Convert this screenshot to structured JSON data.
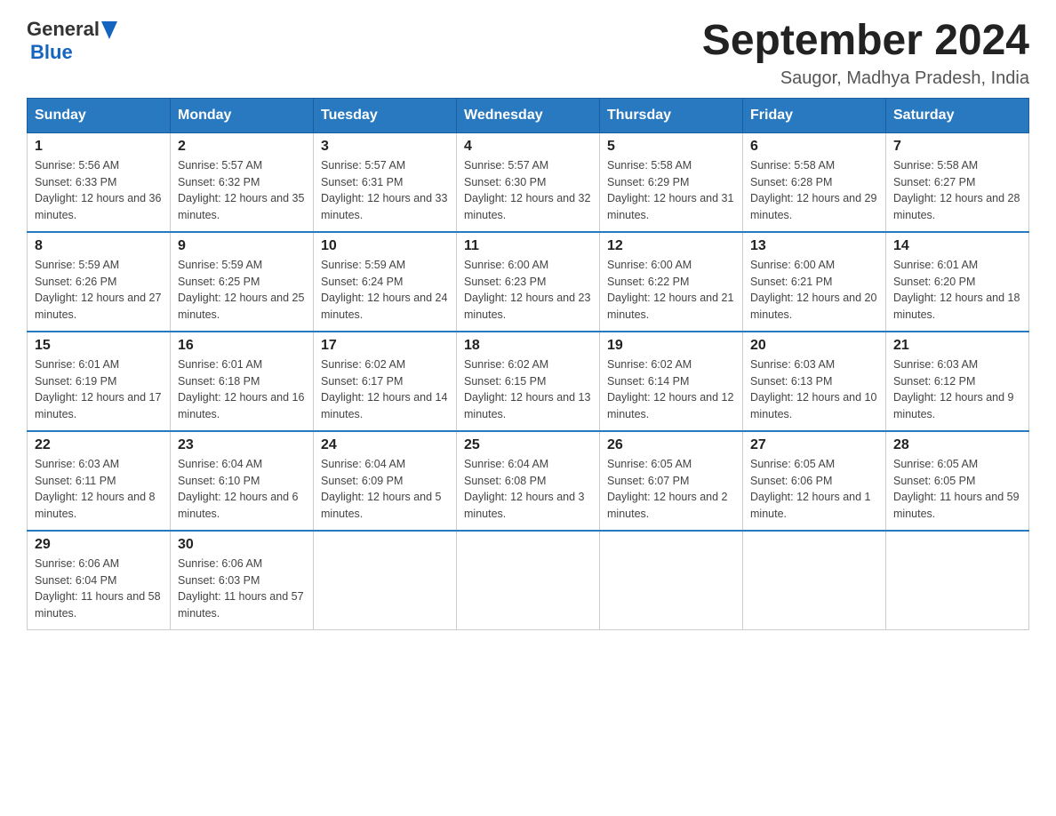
{
  "header": {
    "logo": {
      "text_general": "General",
      "text_blue": "Blue",
      "triangle_alt": "triangle logo"
    },
    "month_year": "September 2024",
    "location": "Saugor, Madhya Pradesh, India"
  },
  "days_of_week": [
    "Sunday",
    "Monday",
    "Tuesday",
    "Wednesday",
    "Thursday",
    "Friday",
    "Saturday"
  ],
  "weeks": [
    [
      {
        "day": "1",
        "sunrise": "5:56 AM",
        "sunset": "6:33 PM",
        "daylight": "12 hours and 36 minutes."
      },
      {
        "day": "2",
        "sunrise": "5:57 AM",
        "sunset": "6:32 PM",
        "daylight": "12 hours and 35 minutes."
      },
      {
        "day": "3",
        "sunrise": "5:57 AM",
        "sunset": "6:31 PM",
        "daylight": "12 hours and 33 minutes."
      },
      {
        "day": "4",
        "sunrise": "5:57 AM",
        "sunset": "6:30 PM",
        "daylight": "12 hours and 32 minutes."
      },
      {
        "day": "5",
        "sunrise": "5:58 AM",
        "sunset": "6:29 PM",
        "daylight": "12 hours and 31 minutes."
      },
      {
        "day": "6",
        "sunrise": "5:58 AM",
        "sunset": "6:28 PM",
        "daylight": "12 hours and 29 minutes."
      },
      {
        "day": "7",
        "sunrise": "5:58 AM",
        "sunset": "6:27 PM",
        "daylight": "12 hours and 28 minutes."
      }
    ],
    [
      {
        "day": "8",
        "sunrise": "5:59 AM",
        "sunset": "6:26 PM",
        "daylight": "12 hours and 27 minutes."
      },
      {
        "day": "9",
        "sunrise": "5:59 AM",
        "sunset": "6:25 PM",
        "daylight": "12 hours and 25 minutes."
      },
      {
        "day": "10",
        "sunrise": "5:59 AM",
        "sunset": "6:24 PM",
        "daylight": "12 hours and 24 minutes."
      },
      {
        "day": "11",
        "sunrise": "6:00 AM",
        "sunset": "6:23 PM",
        "daylight": "12 hours and 23 minutes."
      },
      {
        "day": "12",
        "sunrise": "6:00 AM",
        "sunset": "6:22 PM",
        "daylight": "12 hours and 21 minutes."
      },
      {
        "day": "13",
        "sunrise": "6:00 AM",
        "sunset": "6:21 PM",
        "daylight": "12 hours and 20 minutes."
      },
      {
        "day": "14",
        "sunrise": "6:01 AM",
        "sunset": "6:20 PM",
        "daylight": "12 hours and 18 minutes."
      }
    ],
    [
      {
        "day": "15",
        "sunrise": "6:01 AM",
        "sunset": "6:19 PM",
        "daylight": "12 hours and 17 minutes."
      },
      {
        "day": "16",
        "sunrise": "6:01 AM",
        "sunset": "6:18 PM",
        "daylight": "12 hours and 16 minutes."
      },
      {
        "day": "17",
        "sunrise": "6:02 AM",
        "sunset": "6:17 PM",
        "daylight": "12 hours and 14 minutes."
      },
      {
        "day": "18",
        "sunrise": "6:02 AM",
        "sunset": "6:15 PM",
        "daylight": "12 hours and 13 minutes."
      },
      {
        "day": "19",
        "sunrise": "6:02 AM",
        "sunset": "6:14 PM",
        "daylight": "12 hours and 12 minutes."
      },
      {
        "day": "20",
        "sunrise": "6:03 AM",
        "sunset": "6:13 PM",
        "daylight": "12 hours and 10 minutes."
      },
      {
        "day": "21",
        "sunrise": "6:03 AM",
        "sunset": "6:12 PM",
        "daylight": "12 hours and 9 minutes."
      }
    ],
    [
      {
        "day": "22",
        "sunrise": "6:03 AM",
        "sunset": "6:11 PM",
        "daylight": "12 hours and 8 minutes."
      },
      {
        "day": "23",
        "sunrise": "6:04 AM",
        "sunset": "6:10 PM",
        "daylight": "12 hours and 6 minutes."
      },
      {
        "day": "24",
        "sunrise": "6:04 AM",
        "sunset": "6:09 PM",
        "daylight": "12 hours and 5 minutes."
      },
      {
        "day": "25",
        "sunrise": "6:04 AM",
        "sunset": "6:08 PM",
        "daylight": "12 hours and 3 minutes."
      },
      {
        "day": "26",
        "sunrise": "6:05 AM",
        "sunset": "6:07 PM",
        "daylight": "12 hours and 2 minutes."
      },
      {
        "day": "27",
        "sunrise": "6:05 AM",
        "sunset": "6:06 PM",
        "daylight": "12 hours and 1 minute."
      },
      {
        "day": "28",
        "sunrise": "6:05 AM",
        "sunset": "6:05 PM",
        "daylight": "11 hours and 59 minutes."
      }
    ],
    [
      {
        "day": "29",
        "sunrise": "6:06 AM",
        "sunset": "6:04 PM",
        "daylight": "11 hours and 58 minutes."
      },
      {
        "day": "30",
        "sunrise": "6:06 AM",
        "sunset": "6:03 PM",
        "daylight": "11 hours and 57 minutes."
      },
      null,
      null,
      null,
      null,
      null
    ]
  ]
}
